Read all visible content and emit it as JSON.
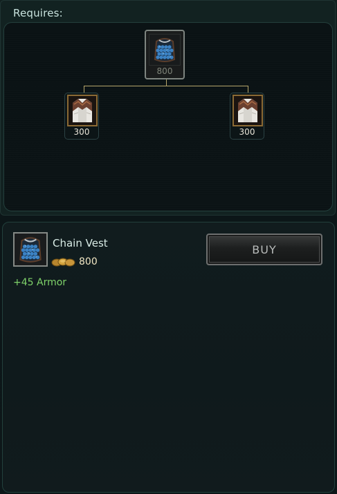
{
  "requires": {
    "title": "Requires:"
  },
  "recipe_tree": {
    "parent": {
      "icon": "chain-vest-icon",
      "cost": "800"
    },
    "children": [
      {
        "icon": "cloth-armor-icon",
        "cost": "300"
      },
      {
        "icon": "cloth-armor-icon",
        "cost": "300"
      }
    ]
  },
  "item_detail": {
    "icon": "chain-vest-icon",
    "name": "Chain Vest",
    "cost": "800",
    "stat": "+45 Armor"
  },
  "buy_button": {
    "label": "BUY"
  },
  "colors": {
    "stat_green": "#7fd36a",
    "gold": "#f1e7c4",
    "tree_line": "#b9a86c"
  }
}
